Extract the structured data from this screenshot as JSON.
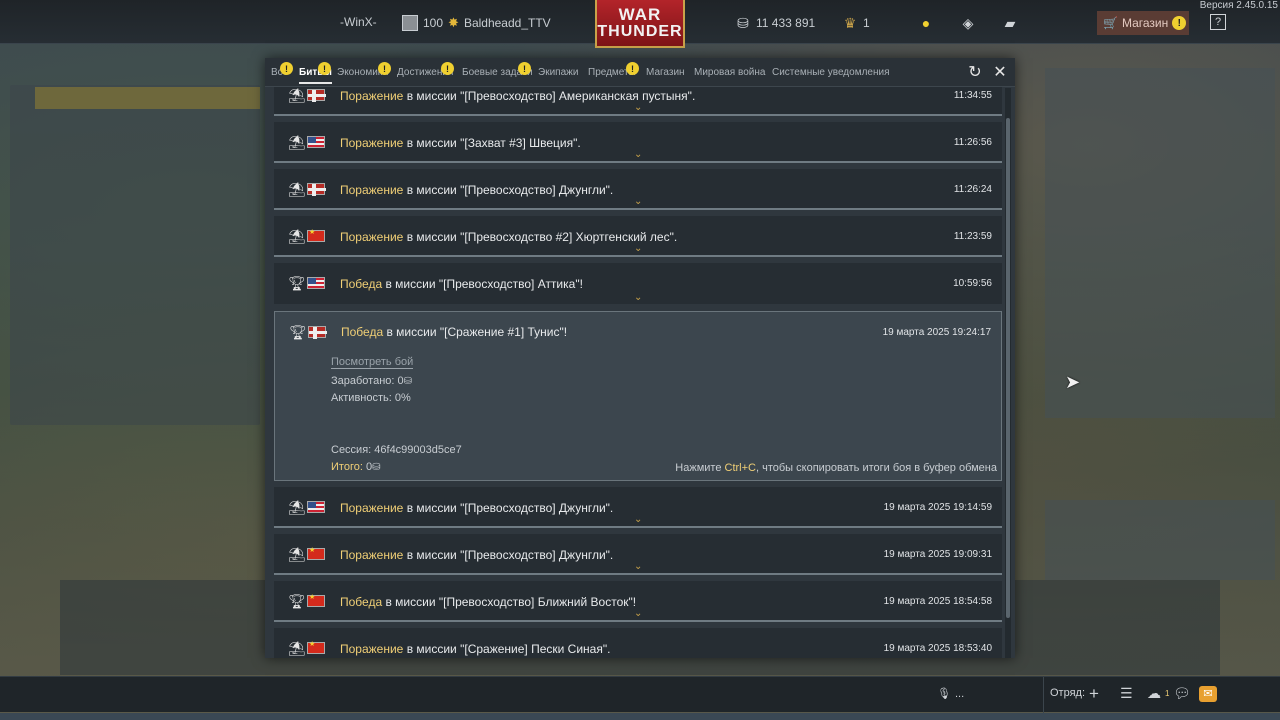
{
  "top_bar": {
    "version": "Версия 2.45.0.15",
    "player_tag": "-WinX-",
    "level": "100",
    "username": "Baldheadd_TTV",
    "logo_line1": "WAR",
    "logo_line2": "THUNDER",
    "silver_lions": "11 433 891",
    "eagles": "1",
    "shop_label": "Магазин",
    "help_icon_glyph": "?"
  },
  "tabs": [
    {
      "label": "Все",
      "badge": "!"
    },
    {
      "label": "Битвы",
      "badge": "!",
      "active": true
    },
    {
      "label": "Экономика",
      "badge": "!"
    },
    {
      "label": "Достижения",
      "badge": "!"
    },
    {
      "label": "Боевые задачи",
      "badge": "!"
    },
    {
      "label": "Экипажи",
      "badge": ""
    },
    {
      "label": "Предметы",
      "badge": "!"
    },
    {
      "label": "Магазин",
      "badge": ""
    },
    {
      "label": "Мировая война",
      "badge": ""
    },
    {
      "label": "Системные уведомления",
      "badge": ""
    }
  ],
  "rows": [
    {
      "icon": "parachute-icon",
      "flag": "de",
      "result": "Поражение",
      "text": " в миссии \"[Превосходство] Американская пустыня\".",
      "time": "11:34:55"
    },
    {
      "icon": "parachute-icon",
      "flag": "us",
      "result": "Поражение",
      "text": " в миссии \"[Захват #3] Швеция\".",
      "time": "11:26:56"
    },
    {
      "icon": "parachute-icon",
      "flag": "de",
      "result": "Поражение",
      "text": " в миссии \"[Превосходство] Джунгли\".",
      "time": "11:26:24"
    },
    {
      "icon": "parachute-icon",
      "flag": "cn",
      "result": "Поражение",
      "text": " в миссии \"[Превосходство #2] Хюртгенский лес\".",
      "time": "11:23:59"
    },
    {
      "icon": "trophy-icon",
      "flag": "us",
      "result": "Победа",
      "text": " в миссии \"[Превосходство] Аттика\"!",
      "time": "10:59:56"
    },
    {
      "icon": "parachute-icon",
      "flag": "us",
      "result": "Поражение",
      "text": " в миссии \"[Превосходство] Джунгли\".",
      "time": "19 марта 2025 19:14:59"
    },
    {
      "icon": "parachute-icon",
      "flag": "cn",
      "result": "Поражение",
      "text": " в миссии \"[Превосходство] Джунгли\".",
      "time": "19 марта 2025 19:09:31"
    },
    {
      "icon": "trophy-icon",
      "flag": "cn",
      "result": "Победа",
      "text": " в миссии \"[Превосходство] Ближний Восток\"!",
      "time": "19 марта 2025 18:54:58"
    },
    {
      "icon": "parachute-icon",
      "flag": "cn",
      "result": "Поражение",
      "text": " в миссии \"[Сражение] Пески Синая\".",
      "time": "19 марта 2025 18:53:40"
    }
  ],
  "expanded": {
    "icon": "trophy-icon",
    "flag": "de",
    "result": "Победа",
    "text": " в миссии \"[Сражение #1] Тунис\"!",
    "time": "19 марта 2025 19:24:17",
    "view_battle": "Посмотреть бой",
    "earned_label": "Заработано: ",
    "earned_value": "0",
    "activity": "Активность: 0%",
    "session": "Сессия: 46f4c99003d5ce7",
    "total_label": "Итого:",
    "total_value": " 0",
    "hint_pre": "Нажмите ",
    "hint_key": "Ctrl+C",
    "hint_post": ", чтобы скопировать итоги боя в буфер обмена"
  },
  "bottom_bar": {
    "voice": "...",
    "squad_label": "Отряд:",
    "friends_count": "1"
  }
}
